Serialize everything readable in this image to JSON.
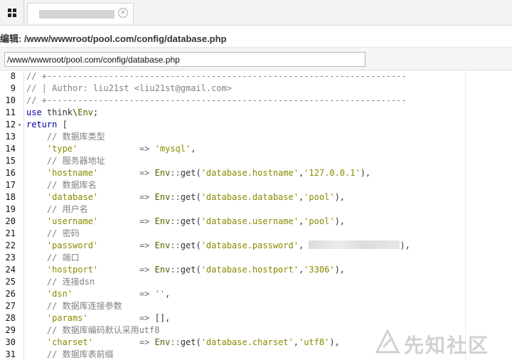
{
  "tabs": {
    "grid_icon": "grid-icon",
    "close_icon": "close-icon",
    "close_glyph": "×"
  },
  "title": {
    "text": "编辑: /www/wwwroot/pool.com/config/database.php"
  },
  "path_field": {
    "value": "/www/wwwroot/pool.com/config/database.php"
  },
  "editor": {
    "lines": [
      {
        "n": "8",
        "text": "// +----------------------------------------------------------------------"
      },
      {
        "n": "9",
        "text": "// | Author: liu21st <liu21st@gmail.com>"
      },
      {
        "n": "10",
        "text": "// +----------------------------------------------------------------------"
      },
      {
        "n": "11",
        "text": "use think\\Env;"
      },
      {
        "n": "12",
        "text": "return ["
      },
      {
        "n": "13",
        "text": "    // 数据库类型"
      },
      {
        "n": "14",
        "text": "    'type'            => 'mysql',"
      },
      {
        "n": "15",
        "text": "    // 服务器地址"
      },
      {
        "n": "16",
        "text": "    'hostname'        => Env::get('database.hostname','127.0.0.1'),"
      },
      {
        "n": "17",
        "text": "    // 数据库名"
      },
      {
        "n": "18",
        "text": "    'database'        => Env::get('database.database','pool'),"
      },
      {
        "n": "19",
        "text": "    // 用户名"
      },
      {
        "n": "20",
        "text": "    'username'        => Env::get('database.username','pool'),"
      },
      {
        "n": "21",
        "text": "    // 密码"
      },
      {
        "n": "22",
        "text": "    'password'        => Env::get('database.password',"
      },
      {
        "n": "23",
        "text": "    // 端口"
      },
      {
        "n": "24",
        "text": "    'hostport'        => Env::get('database.hostport','3306'),"
      },
      {
        "n": "25",
        "text": "    // 连接dsn"
      },
      {
        "n": "26",
        "text": "    'dsn'             => '',"
      },
      {
        "n": "27",
        "text": "    // 数据库连接参数"
      },
      {
        "n": "28",
        "text": "    'params'          => [],"
      },
      {
        "n": "29",
        "text": "    // 数据库编码默认采用utf8"
      },
      {
        "n": "30",
        "text": "    'charset'         => Env::get('database.charset','utf8'),"
      },
      {
        "n": "31",
        "text": "    // 数据库表前缀"
      }
    ],
    "fold_marker": "▾",
    "line22_tail": "),"
  },
  "watermark": {
    "text": "先知社区"
  }
}
